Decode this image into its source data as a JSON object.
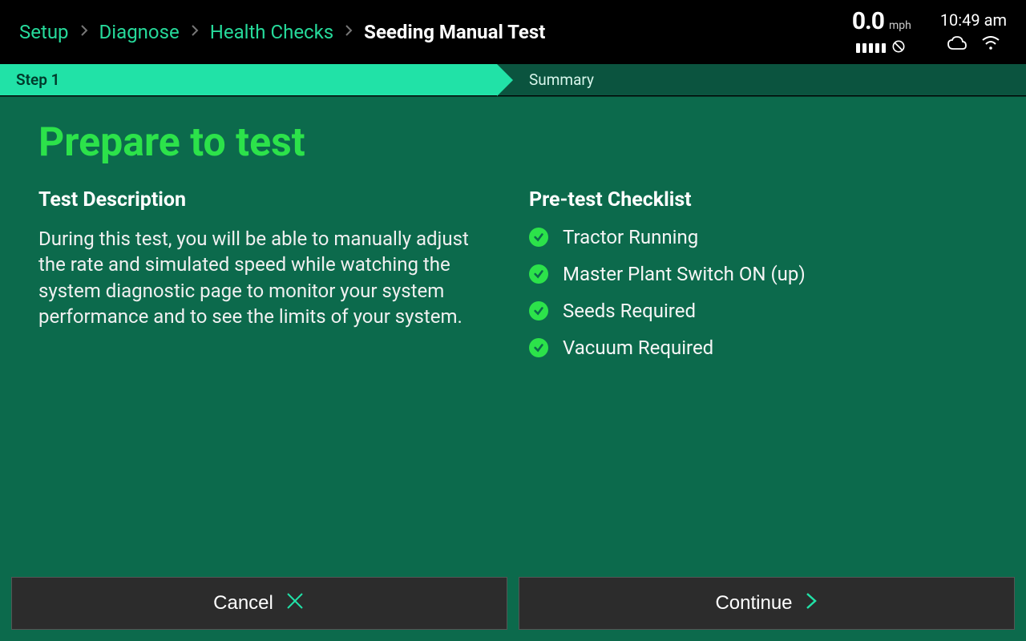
{
  "breadcrumb": {
    "items": [
      "Setup",
      "Diagnose",
      "Health Checks",
      "Seeding Manual Test"
    ]
  },
  "status": {
    "speed_value": "0.0",
    "speed_unit": "mph",
    "time": "10:49 am"
  },
  "steps": {
    "active": "Step 1",
    "next": "Summary"
  },
  "page": {
    "title": "Prepare to test",
    "desc_heading": "Test Description",
    "desc_body": "During this test, you will be able to manually adjust the rate and simulated speed while watching the system diagnostic page to monitor your system performance and to see the limits of your system.",
    "checklist_heading": "Pre-test Checklist",
    "checklist": [
      "Tractor Running",
      "Master Plant Switch ON (up)",
      "Seeds Required",
      "Vacuum Required"
    ]
  },
  "footer": {
    "cancel": "Cancel",
    "continue": "Continue"
  }
}
